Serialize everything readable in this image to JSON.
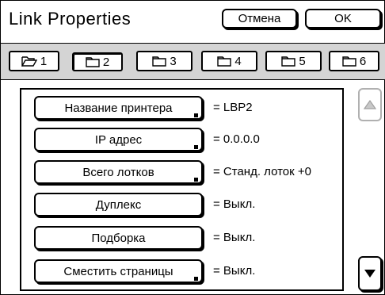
{
  "window": {
    "title": "Link Properties"
  },
  "actions": {
    "cancel_label": "Отмена",
    "ok_label": "OK"
  },
  "tabs": [
    {
      "label": "1",
      "icon": "folder-open-icon",
      "active": false
    },
    {
      "label": "2",
      "icon": "folder-icon",
      "active": true
    },
    {
      "label": "3",
      "icon": "folder-icon",
      "active": false
    },
    {
      "label": "4",
      "icon": "folder-icon",
      "active": false
    },
    {
      "label": "5",
      "icon": "folder-icon",
      "active": false
    },
    {
      "label": "6",
      "icon": "folder-icon",
      "active": false
    }
  ],
  "settings": [
    {
      "label": "Название принтера",
      "value": "= LBP2"
    },
    {
      "label": "IP адрес",
      "value": "= 0.0.0.0"
    },
    {
      "label": "Всего лотков",
      "value": "= Станд. лоток +0"
    },
    {
      "label": "Дуплекс",
      "value": "= Выкл."
    },
    {
      "label": "Подборка",
      "value": "= Выкл."
    },
    {
      "label": "Сместить страницы",
      "value": "= Выкл."
    }
  ],
  "scroll": {
    "up_icon": "scroll-up-icon",
    "down_icon": "scroll-down-icon",
    "up_enabled": false,
    "down_enabled": true
  }
}
